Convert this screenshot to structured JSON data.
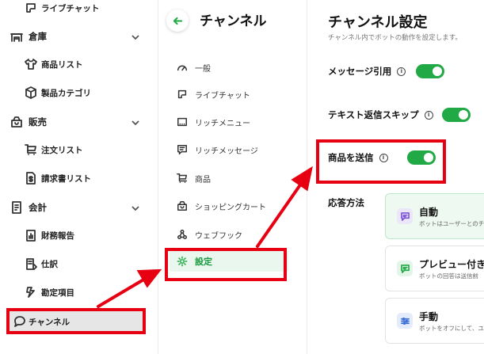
{
  "sidebar": {
    "items": [
      {
        "label": "ライブチャット",
        "icon": "live-chat-icon"
      },
      {
        "label": "倉庫",
        "icon": "warehouse-icon"
      },
      {
        "label": "商品リスト",
        "icon": "shirt-icon"
      },
      {
        "label": "製品カテゴリ",
        "icon": "cube-icon"
      },
      {
        "label": "販売",
        "icon": "shop-icon"
      },
      {
        "label": "注文リスト",
        "icon": "cart-icon"
      },
      {
        "label": "請求書リスト",
        "icon": "invoice-icon"
      },
      {
        "label": "会計",
        "icon": "accounting-icon"
      },
      {
        "label": "財務報告",
        "icon": "report-icon"
      },
      {
        "label": "仕訳",
        "icon": "journal-icon"
      },
      {
        "label": "勘定項目",
        "icon": "account-item-icon"
      },
      {
        "label": "チャンネル",
        "icon": "chat-bubble-icon"
      }
    ]
  },
  "menu": {
    "title": "チャンネル",
    "items": [
      {
        "label": "一般",
        "icon": "gauge-icon"
      },
      {
        "label": "ライブチャット",
        "icon": "live-chat-icon"
      },
      {
        "label": "リッチメニュー",
        "icon": "rich-menu-icon"
      },
      {
        "label": "リッチメッセージ",
        "icon": "rich-message-icon"
      },
      {
        "label": "商品",
        "icon": "cart-icon"
      },
      {
        "label": "ショッピングカート",
        "icon": "shop-icon"
      },
      {
        "label": "ウェブフック",
        "icon": "webhook-icon"
      },
      {
        "label": "設定",
        "icon": "gear-icon"
      }
    ]
  },
  "content": {
    "title": "チャンネル設定",
    "subtitle": "チャンネル内でボットの動作を設定します。",
    "settings": [
      {
        "label": "メッセージ引用",
        "enabled": true
      },
      {
        "label": "テキスト返信スキップ",
        "enabled": true
      },
      {
        "label": "商品を送信",
        "enabled": true
      }
    ],
    "response_label": "応答方法",
    "cards": [
      {
        "title": "自動",
        "desc": "ボットはユーザーとのチャ",
        "icon": "auto-reply-icon"
      },
      {
        "title": "プレビュー付き自",
        "desc": "ボットの回答は送信前",
        "icon": "preview-icon"
      },
      {
        "title": "手動",
        "desc": "ボットをオフにして、ユー",
        "icon": "manual-icon"
      }
    ],
    "info_glyph": "i"
  },
  "colors": {
    "accent_green": "#21a945",
    "annotation_red": "#e60012"
  }
}
